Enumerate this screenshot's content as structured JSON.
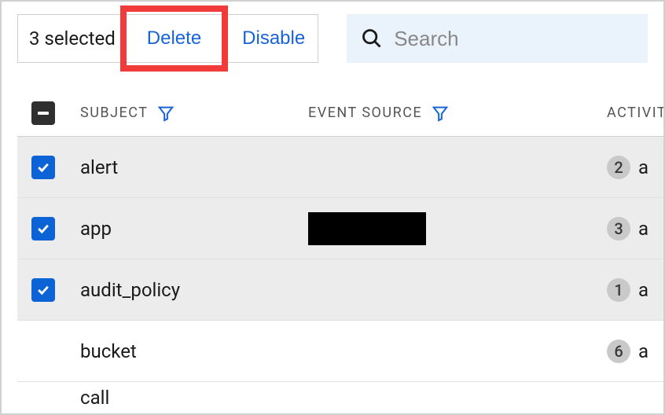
{
  "toolbar": {
    "selection_text": "3 selected",
    "delete_label": "Delete",
    "disable_label": "Disable"
  },
  "search": {
    "placeholder": "Search",
    "value": ""
  },
  "columns": {
    "subject": "SUBJECT",
    "event_source": "EVENT SOURCE",
    "activity": "ACTIVITY"
  },
  "rows": [
    {
      "selected": true,
      "subject": "alert",
      "event_source": "",
      "activity_count": 2,
      "activity_letter": "a"
    },
    {
      "selected": true,
      "subject": "app",
      "event_source": "REDACTED",
      "activity_count": 3,
      "activity_letter": "a"
    },
    {
      "selected": true,
      "subject": "audit_policy",
      "event_source": "",
      "activity_count": 1,
      "activity_letter": "a"
    },
    {
      "selected": false,
      "subject": "bucket",
      "event_source": "",
      "activity_count": 6,
      "activity_letter": "a"
    },
    {
      "selected": false,
      "subject": "call",
      "event_source": "",
      "activity_count": null,
      "activity_letter": ""
    }
  ]
}
